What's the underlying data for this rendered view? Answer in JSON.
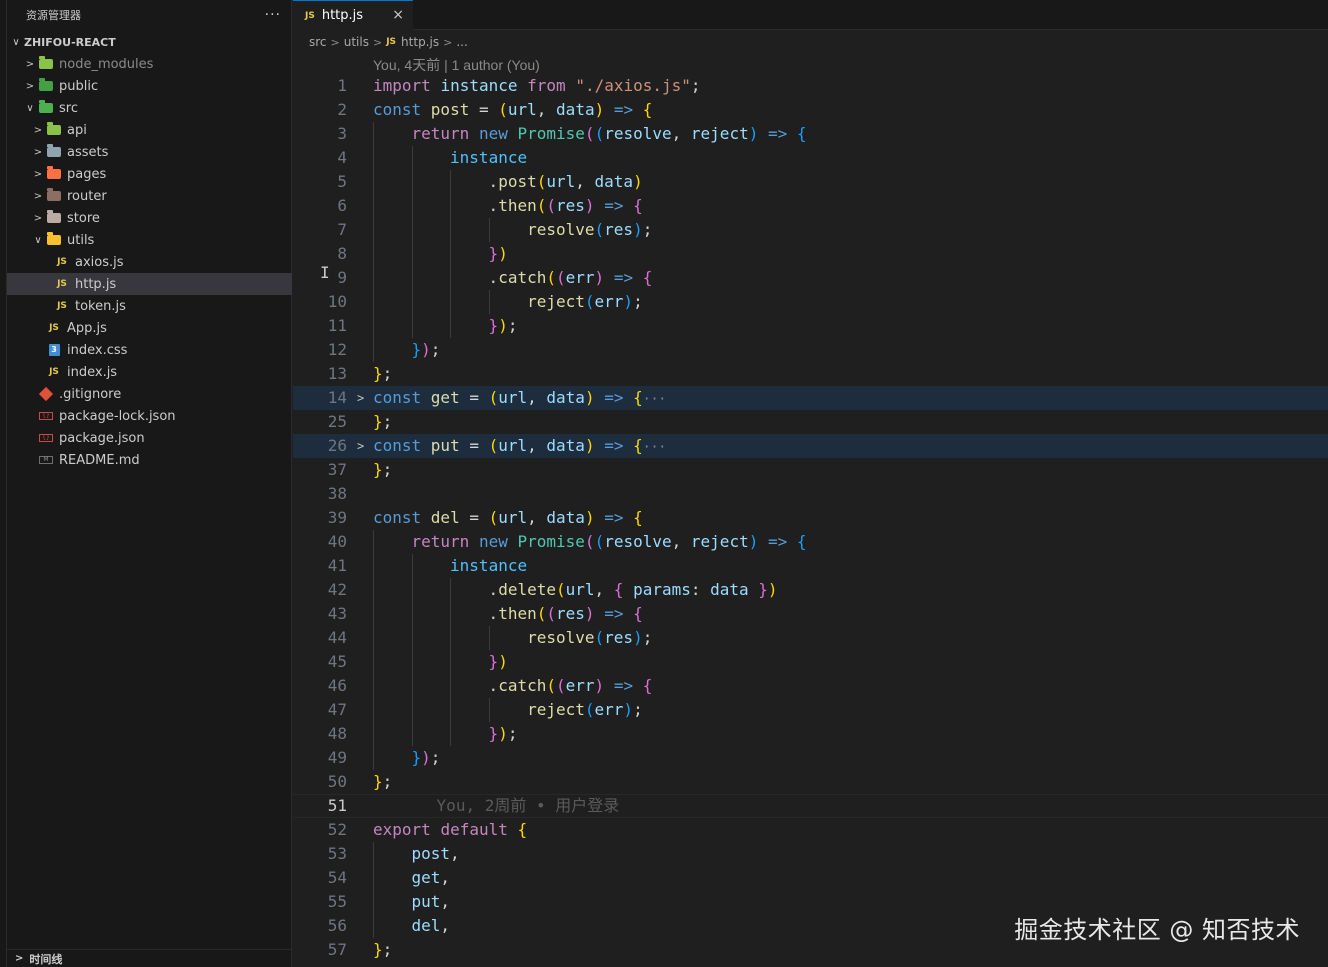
{
  "sidebar": {
    "title": "资源管理器",
    "more": "···",
    "project": "ZHIFOU-REACT",
    "items": [
      {
        "label": "node_modules",
        "type": "folder",
        "depth": 0,
        "expanded": false,
        "color": "#8bc34a",
        "dim": true
      },
      {
        "label": "public",
        "type": "folder",
        "depth": 0,
        "expanded": false,
        "color": "#43a047"
      },
      {
        "label": "src",
        "type": "folder",
        "depth": 0,
        "expanded": true,
        "color": "#4caf50"
      },
      {
        "label": "api",
        "type": "folder",
        "depth": 1,
        "expanded": false,
        "color": "#8bc34a"
      },
      {
        "label": "assets",
        "type": "folder",
        "depth": 1,
        "expanded": false,
        "color": "#90a4ae"
      },
      {
        "label": "pages",
        "type": "folder",
        "depth": 1,
        "expanded": false,
        "color": "#ff7043"
      },
      {
        "label": "router",
        "type": "folder",
        "depth": 1,
        "expanded": false,
        "color": "#8d6e63"
      },
      {
        "label": "store",
        "type": "folder",
        "depth": 1,
        "expanded": false,
        "color": "#bcaaa4"
      },
      {
        "label": "utils",
        "type": "folder",
        "depth": 1,
        "expanded": true,
        "color": "#fbc02d"
      },
      {
        "label": "axios.js",
        "type": "js",
        "depth": 2
      },
      {
        "label": "http.js",
        "type": "js",
        "depth": 2,
        "selected": true
      },
      {
        "label": "token.js",
        "type": "js",
        "depth": 2
      },
      {
        "label": "App.js",
        "type": "js",
        "depth": 1
      },
      {
        "label": "index.css",
        "type": "css",
        "depth": 1
      },
      {
        "label": "index.js",
        "type": "js",
        "depth": 1
      },
      {
        "label": ".gitignore",
        "type": "git",
        "depth": 0
      },
      {
        "label": "package-lock.json",
        "type": "json",
        "depth": 0
      },
      {
        "label": "package.json",
        "type": "json",
        "depth": 0
      },
      {
        "label": "README.md",
        "type": "md",
        "depth": 0
      }
    ],
    "timeline": "时间线"
  },
  "editor": {
    "tab": {
      "label": "http.js",
      "badge": "JS",
      "close": "×"
    },
    "breadcrumb": [
      "src",
      "utils",
      "http.js",
      "..."
    ],
    "blame_header": "You, 4天前 | 1 author (You)",
    "inline_blame": "You, 2周前 • 用户登录",
    "lines": [
      {
        "n": "1",
        "ind": 0,
        "t": [
          [
            "kc",
            "import "
          ],
          [
            "v",
            "instance "
          ],
          [
            "kc",
            "from "
          ],
          [
            "s",
            "\"./axios.js\""
          ],
          [
            "p",
            ";"
          ]
        ]
      },
      {
        "n": "2",
        "ind": 0,
        "t": [
          [
            "k",
            "const "
          ],
          [
            "f",
            "post "
          ],
          [
            "p",
            "= "
          ],
          [
            "b1",
            "("
          ],
          [
            "v",
            "url"
          ],
          [
            "p",
            ", "
          ],
          [
            "v",
            "data"
          ],
          [
            "b1",
            ")"
          ],
          [
            "p",
            " "
          ],
          [
            "k",
            "=>"
          ],
          [
            "p",
            " "
          ],
          [
            "b1",
            "{"
          ]
        ]
      },
      {
        "n": "3",
        "ind": 1,
        "t": [
          [
            "kc",
            "return "
          ],
          [
            "k",
            "new "
          ],
          [
            "c",
            "Promise"
          ],
          [
            "b2",
            "("
          ],
          [
            "b3",
            "("
          ],
          [
            "v",
            "resolve"
          ],
          [
            "p",
            ", "
          ],
          [
            "v",
            "reject"
          ],
          [
            "b3",
            ")"
          ],
          [
            "p",
            " "
          ],
          [
            "k",
            "=>"
          ],
          [
            "p",
            " "
          ],
          [
            "b3",
            "{"
          ]
        ]
      },
      {
        "n": "4",
        "ind": 2,
        "t": [
          [
            "cv",
            "instance"
          ]
        ]
      },
      {
        "n": "5",
        "ind": 3,
        "t": [
          [
            "p",
            "."
          ],
          [
            "f",
            "post"
          ],
          [
            "b1",
            "("
          ],
          [
            "v",
            "url"
          ],
          [
            "p",
            ", "
          ],
          [
            "v",
            "data"
          ],
          [
            "b1",
            ")"
          ]
        ]
      },
      {
        "n": "6",
        "ind": 3,
        "t": [
          [
            "p",
            "."
          ],
          [
            "f",
            "then"
          ],
          [
            "b1",
            "("
          ],
          [
            "b2",
            "("
          ],
          [
            "v",
            "res"
          ],
          [
            "b2",
            ")"
          ],
          [
            "p",
            " "
          ],
          [
            "k",
            "=>"
          ],
          [
            "p",
            " "
          ],
          [
            "b2",
            "{"
          ]
        ]
      },
      {
        "n": "7",
        "ind": 4,
        "t": [
          [
            "f",
            "resolve"
          ],
          [
            "b3",
            "("
          ],
          [
            "v",
            "res"
          ],
          [
            "b3",
            ")"
          ],
          [
            "p",
            ";"
          ]
        ]
      },
      {
        "n": "8",
        "ind": 3,
        "t": [
          [
            "b2",
            "}"
          ],
          [
            "b1",
            ")"
          ]
        ]
      },
      {
        "n": "9",
        "ind": 3,
        "t": [
          [
            "p",
            "."
          ],
          [
            "f",
            "catch"
          ],
          [
            "b1",
            "("
          ],
          [
            "b2",
            "("
          ],
          [
            "v",
            "err"
          ],
          [
            "b2",
            ")"
          ],
          [
            "p",
            " "
          ],
          [
            "k",
            "=>"
          ],
          [
            "p",
            " "
          ],
          [
            "b2",
            "{"
          ]
        ]
      },
      {
        "n": "10",
        "ind": 4,
        "t": [
          [
            "f",
            "reject"
          ],
          [
            "b3",
            "("
          ],
          [
            "v",
            "err"
          ],
          [
            "b3",
            ")"
          ],
          [
            "p",
            ";"
          ]
        ]
      },
      {
        "n": "11",
        "ind": 3,
        "t": [
          [
            "b2",
            "}"
          ],
          [
            "b1",
            ")"
          ],
          [
            "p",
            ";"
          ]
        ]
      },
      {
        "n": "12",
        "ind": 1,
        "t": [
          [
            "b3",
            "}"
          ],
          [
            "b2",
            ")"
          ],
          [
            "p",
            ";"
          ]
        ]
      },
      {
        "n": "13",
        "ind": 0,
        "t": [
          [
            "b1",
            "}"
          ],
          [
            "p",
            ";"
          ]
        ]
      },
      {
        "n": "14",
        "ind": 0,
        "fold": true,
        "t": [
          [
            "k",
            "const "
          ],
          [
            "f",
            "get "
          ],
          [
            "p",
            "= "
          ],
          [
            "b1",
            "("
          ],
          [
            "v",
            "url"
          ],
          [
            "p",
            ", "
          ],
          [
            "v",
            "data"
          ],
          [
            "b1",
            ")"
          ],
          [
            "p",
            " "
          ],
          [
            "k",
            "=>"
          ],
          [
            "p",
            " "
          ],
          [
            "b1",
            "{"
          ],
          [
            "ell",
            "···"
          ]
        ]
      },
      {
        "n": "25",
        "ind": 0,
        "t": [
          [
            "b1",
            "}"
          ],
          [
            "p",
            ";"
          ]
        ]
      },
      {
        "n": "26",
        "ind": 0,
        "fold": true,
        "t": [
          [
            "k",
            "const "
          ],
          [
            "f",
            "put "
          ],
          [
            "p",
            "= "
          ],
          [
            "b1",
            "("
          ],
          [
            "v",
            "url"
          ],
          [
            "p",
            ", "
          ],
          [
            "v",
            "data"
          ],
          [
            "b1",
            ")"
          ],
          [
            "p",
            " "
          ],
          [
            "k",
            "=>"
          ],
          [
            "p",
            " "
          ],
          [
            "b1",
            "{"
          ],
          [
            "ell",
            "···"
          ]
        ]
      },
      {
        "n": "37",
        "ind": 0,
        "t": [
          [
            "b1",
            "}"
          ],
          [
            "p",
            ";"
          ]
        ]
      },
      {
        "n": "38",
        "ind": 0,
        "t": []
      },
      {
        "n": "39",
        "ind": 0,
        "t": [
          [
            "k",
            "const "
          ],
          [
            "f",
            "del "
          ],
          [
            "p",
            "= "
          ],
          [
            "b1",
            "("
          ],
          [
            "v",
            "url"
          ],
          [
            "p",
            ", "
          ],
          [
            "v",
            "data"
          ],
          [
            "b1",
            ")"
          ],
          [
            "p",
            " "
          ],
          [
            "k",
            "=>"
          ],
          [
            "p",
            " "
          ],
          [
            "b1",
            "{"
          ]
        ]
      },
      {
        "n": "40",
        "ind": 1,
        "t": [
          [
            "kc",
            "return "
          ],
          [
            "k",
            "new "
          ],
          [
            "c",
            "Promise"
          ],
          [
            "b2",
            "("
          ],
          [
            "b3",
            "("
          ],
          [
            "v",
            "resolve"
          ],
          [
            "p",
            ", "
          ],
          [
            "v",
            "reject"
          ],
          [
            "b3",
            ")"
          ],
          [
            "p",
            " "
          ],
          [
            "k",
            "=>"
          ],
          [
            "p",
            " "
          ],
          [
            "b3",
            "{"
          ]
        ]
      },
      {
        "n": "41",
        "ind": 2,
        "t": [
          [
            "cv",
            "instance"
          ]
        ]
      },
      {
        "n": "42",
        "ind": 3,
        "t": [
          [
            "p",
            "."
          ],
          [
            "f",
            "delete"
          ],
          [
            "b1",
            "("
          ],
          [
            "v",
            "url"
          ],
          [
            "p",
            ", "
          ],
          [
            "b2",
            "{ "
          ],
          [
            "v",
            "params"
          ],
          [
            "p",
            ": "
          ],
          [
            "v",
            "data"
          ],
          [
            "b2",
            " }"
          ],
          [
            "b1",
            ")"
          ]
        ]
      },
      {
        "n": "43",
        "ind": 3,
        "t": [
          [
            "p",
            "."
          ],
          [
            "f",
            "then"
          ],
          [
            "b1",
            "("
          ],
          [
            "b2",
            "("
          ],
          [
            "v",
            "res"
          ],
          [
            "b2",
            ")"
          ],
          [
            "p",
            " "
          ],
          [
            "k",
            "=>"
          ],
          [
            "p",
            " "
          ],
          [
            "b2",
            "{"
          ]
        ]
      },
      {
        "n": "44",
        "ind": 4,
        "t": [
          [
            "f",
            "resolve"
          ],
          [
            "b3",
            "("
          ],
          [
            "v",
            "res"
          ],
          [
            "b3",
            ")"
          ],
          [
            "p",
            ";"
          ]
        ]
      },
      {
        "n": "45",
        "ind": 3,
        "t": [
          [
            "b2",
            "}"
          ],
          [
            "b1",
            ")"
          ]
        ]
      },
      {
        "n": "46",
        "ind": 3,
        "t": [
          [
            "p",
            "."
          ],
          [
            "f",
            "catch"
          ],
          [
            "b1",
            "("
          ],
          [
            "b2",
            "("
          ],
          [
            "v",
            "err"
          ],
          [
            "b2",
            ")"
          ],
          [
            "p",
            " "
          ],
          [
            "k",
            "=>"
          ],
          [
            "p",
            " "
          ],
          [
            "b2",
            "{"
          ]
        ]
      },
      {
        "n": "47",
        "ind": 4,
        "t": [
          [
            "f",
            "reject"
          ],
          [
            "b3",
            "("
          ],
          [
            "v",
            "err"
          ],
          [
            "b3",
            ")"
          ],
          [
            "p",
            ";"
          ]
        ]
      },
      {
        "n": "48",
        "ind": 3,
        "t": [
          [
            "b2",
            "}"
          ],
          [
            "b1",
            ")"
          ],
          [
            "p",
            ";"
          ]
        ]
      },
      {
        "n": "49",
        "ind": 1,
        "t": [
          [
            "b3",
            "}"
          ],
          [
            "b2",
            ")"
          ],
          [
            "p",
            ";"
          ]
        ]
      },
      {
        "n": "50",
        "ind": 0,
        "t": [
          [
            "b1",
            "}"
          ],
          [
            "p",
            ";"
          ]
        ]
      },
      {
        "n": "51",
        "ind": 0,
        "current": true,
        "blame": true,
        "t": []
      },
      {
        "n": "52",
        "ind": 0,
        "t": [
          [
            "kc",
            "export "
          ],
          [
            "kc",
            "default "
          ],
          [
            "b1",
            "{"
          ]
        ]
      },
      {
        "n": "53",
        "ind": 1,
        "t": [
          [
            "v",
            "post"
          ],
          [
            "p",
            ","
          ]
        ]
      },
      {
        "n": "54",
        "ind": 1,
        "t": [
          [
            "v",
            "get"
          ],
          [
            "p",
            ","
          ]
        ]
      },
      {
        "n": "55",
        "ind": 1,
        "t": [
          [
            "v",
            "put"
          ],
          [
            "p",
            ","
          ]
        ]
      },
      {
        "n": "56",
        "ind": 1,
        "t": [
          [
            "v",
            "del"
          ],
          [
            "p",
            ","
          ]
        ]
      },
      {
        "n": "57",
        "ind": 0,
        "t": [
          [
            "b1",
            "}"
          ],
          [
            "p",
            ";"
          ]
        ]
      }
    ]
  },
  "watermark": "掘金技术社区 @ 知否技术"
}
